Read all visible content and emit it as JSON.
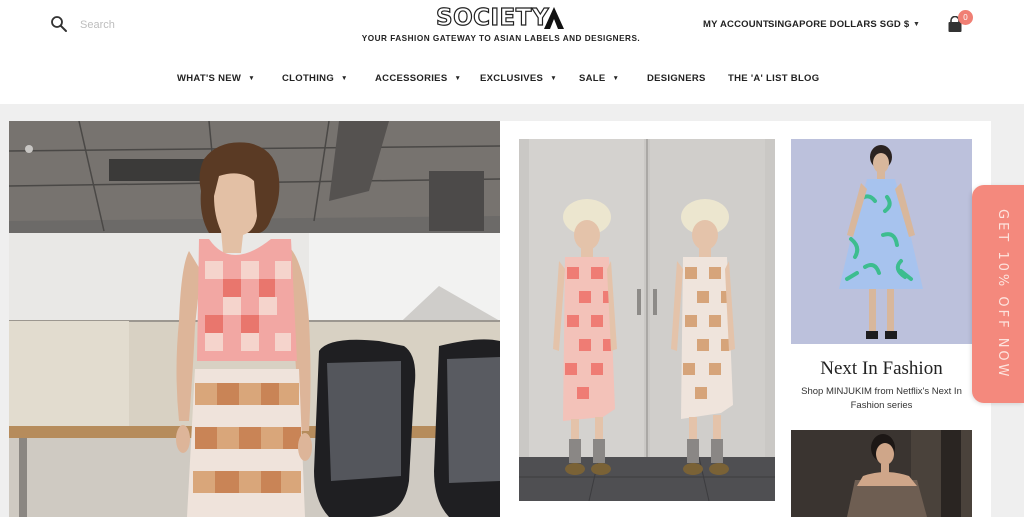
{
  "header": {
    "search": {
      "placeholder": "Search",
      "icon": "search-icon"
    },
    "logo": {
      "text": "SOCIETY",
      "mark": "A"
    },
    "tagline": "YOUR FASHION GATEWAY TO ASIAN LABELS AND DESIGNERS.",
    "account_label": "MY ACCOUNT",
    "currency_label": "SINGAPORE DOLLARS SGD $",
    "cart": {
      "icon": "shopping-bag-icon",
      "count": "0"
    }
  },
  "nav": {
    "items": [
      {
        "label": "WHAT'S NEW",
        "has_dropdown": true
      },
      {
        "label": "CLOTHING",
        "has_dropdown": true
      },
      {
        "label": "ACCESSORIES",
        "has_dropdown": true
      },
      {
        "label": "EXCLUSIVES",
        "has_dropdown": true
      },
      {
        "label": "SALE",
        "has_dropdown": true
      },
      {
        "label": "DESIGNERS",
        "has_dropdown": false
      },
      {
        "label": "THE 'A' LIST BLOG",
        "has_dropdown": false
      }
    ]
  },
  "feature": {
    "title": "Next In Fashion",
    "subtitle": "Shop MINJUKIM from Netflix's Next In Fashion series"
  },
  "promo": {
    "text": "GET 10% OFF NOW"
  },
  "colors": {
    "accent": "#f4897d",
    "badge": "#f07f74",
    "text": "#222222",
    "background": "#efefef"
  }
}
